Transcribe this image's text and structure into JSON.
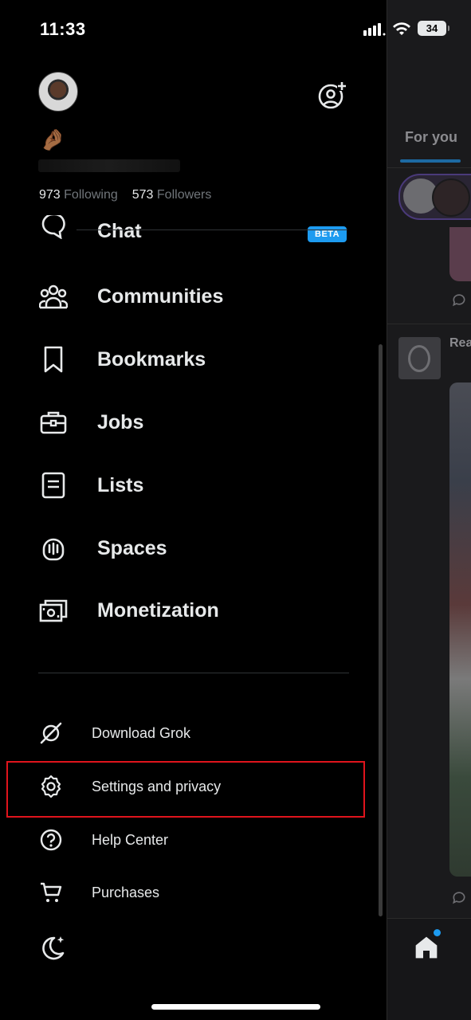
{
  "status_bar": {
    "time": "11:33",
    "battery": "34"
  },
  "profile": {
    "emoji": "🤌🏾",
    "following_count": "973",
    "following_label": "Following",
    "followers_count": "573",
    "followers_label": "Followers"
  },
  "menu": {
    "chat": {
      "label": "Chat",
      "badge": "BETA"
    },
    "communities": "Communities",
    "bookmarks": "Bookmarks",
    "jobs": "Jobs",
    "lists": "Lists",
    "spaces": "Spaces",
    "monetization": "Monetization"
  },
  "secondary_menu": {
    "download_grok": "Download Grok",
    "settings_privacy": "Settings and privacy",
    "help_center": "Help Center",
    "purchases": "Purchases"
  },
  "background": {
    "tab_for_you": "For you",
    "post_author_partial": "Rea"
  },
  "colors": {
    "accent": "#1d9bf0",
    "highlight": "#e0141c",
    "text": "#e7e9ea",
    "muted": "#71767b"
  }
}
